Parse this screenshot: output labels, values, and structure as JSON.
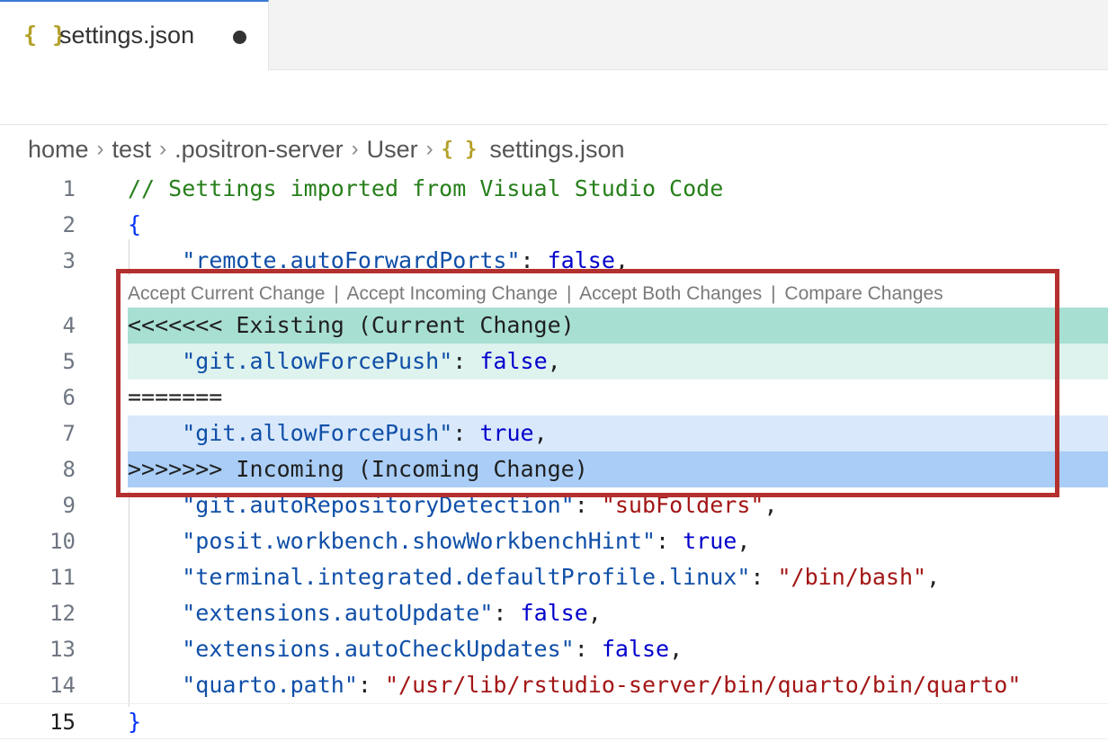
{
  "tab": {
    "icon": "{ }",
    "label": "settings.json",
    "dirty_indicator": "●"
  },
  "breadcrumb": {
    "items": [
      "home",
      "test",
      ".positron-server",
      "User",
      "settings.json"
    ],
    "file_icon": "{ }",
    "separator": "›"
  },
  "codelens": {
    "accept_current": "Accept Current Change",
    "accept_incoming": "Accept Incoming Change",
    "accept_both": "Accept Both Changes",
    "compare": "Compare Changes",
    "separator": "|"
  },
  "lines": [
    {
      "number": "1",
      "tokens": [
        {
          "t": "// Settings imported from Visual Studio Code",
          "k": "comment"
        }
      ]
    },
    {
      "number": "2",
      "tokens": [
        {
          "t": "{",
          "k": "brace"
        }
      ]
    },
    {
      "number": "3",
      "tokens": [
        {
          "t": "    ",
          "k": "punct"
        },
        {
          "t": "\"remote.autoForwardPorts\"",
          "k": "key"
        },
        {
          "t": ": ",
          "k": "punct"
        },
        {
          "t": "false",
          "k": "bool"
        },
        {
          "t": ",",
          "k": "punct"
        }
      ]
    },
    {
      "number": "4",
      "tokens": [
        {
          "t": "<<<<<<< Existing (Current Change)",
          "k": "punct"
        }
      ]
    },
    {
      "number": "5",
      "tokens": [
        {
          "t": "    ",
          "k": "punct"
        },
        {
          "t": "\"git.allowForcePush\"",
          "k": "key"
        },
        {
          "t": ": ",
          "k": "punct"
        },
        {
          "t": "false",
          "k": "bool"
        },
        {
          "t": ",",
          "k": "punct"
        }
      ]
    },
    {
      "number": "6",
      "tokens": [
        {
          "t": "=======",
          "k": "punct"
        }
      ]
    },
    {
      "number": "7",
      "tokens": [
        {
          "t": "    ",
          "k": "punct"
        },
        {
          "t": "\"git.allowForcePush\"",
          "k": "key"
        },
        {
          "t": ": ",
          "k": "punct"
        },
        {
          "t": "true",
          "k": "bool"
        },
        {
          "t": ",",
          "k": "punct"
        }
      ]
    },
    {
      "number": "8",
      "tokens": [
        {
          "t": ">>>>>>> Incoming (Incoming Change)",
          "k": "punct"
        }
      ]
    },
    {
      "number": "9",
      "tokens": [
        {
          "t": "    ",
          "k": "punct"
        },
        {
          "t": "\"git.autoRepositoryDetection\"",
          "k": "key"
        },
        {
          "t": ": ",
          "k": "punct"
        },
        {
          "t": "\"subFolders\"",
          "k": "str"
        },
        {
          "t": ",",
          "k": "punct"
        }
      ]
    },
    {
      "number": "10",
      "tokens": [
        {
          "t": "    ",
          "k": "punct"
        },
        {
          "t": "\"posit.workbench.showWorkbenchHint\"",
          "k": "key"
        },
        {
          "t": ": ",
          "k": "punct"
        },
        {
          "t": "true",
          "k": "bool"
        },
        {
          "t": ",",
          "k": "punct"
        }
      ]
    },
    {
      "number": "11",
      "tokens": [
        {
          "t": "    ",
          "k": "punct"
        },
        {
          "t": "\"terminal.integrated.defaultProfile.linux\"",
          "k": "key"
        },
        {
          "t": ": ",
          "k": "punct"
        },
        {
          "t": "\"/bin/bash\"",
          "k": "str"
        },
        {
          "t": ",",
          "k": "punct"
        }
      ]
    },
    {
      "number": "12",
      "tokens": [
        {
          "t": "    ",
          "k": "punct"
        },
        {
          "t": "\"extensions.autoUpdate\"",
          "k": "key"
        },
        {
          "t": ": ",
          "k": "punct"
        },
        {
          "t": "false",
          "k": "bool"
        },
        {
          "t": ",",
          "k": "punct"
        }
      ]
    },
    {
      "number": "13",
      "tokens": [
        {
          "t": "    ",
          "k": "punct"
        },
        {
          "t": "\"extensions.autoCheckUpdates\"",
          "k": "key"
        },
        {
          "t": ": ",
          "k": "punct"
        },
        {
          "t": "false",
          "k": "bool"
        },
        {
          "t": ",",
          "k": "punct"
        }
      ]
    },
    {
      "number": "14",
      "tokens": [
        {
          "t": "    ",
          "k": "punct"
        },
        {
          "t": "\"quarto.path\"",
          "k": "key"
        },
        {
          "t": ": ",
          "k": "punct"
        },
        {
          "t": "\"/usr/lib/rstudio-server/bin/quarto/bin/quarto\"",
          "k": "str"
        }
      ]
    },
    {
      "number": "15",
      "tokens": [
        {
          "t": "}",
          "k": "brace"
        }
      ]
    }
  ],
  "colors": {
    "current_header": "#a8dfd3",
    "current_body": "#def2ee",
    "incoming_body": "#d9e9fb",
    "incoming_header": "#a9cdf6",
    "highlight_border": "#b3302f",
    "json_key": "#0f4fa8",
    "json_string": "#a31515",
    "json_bool": "#0000cc",
    "comment": "#267f1a"
  }
}
